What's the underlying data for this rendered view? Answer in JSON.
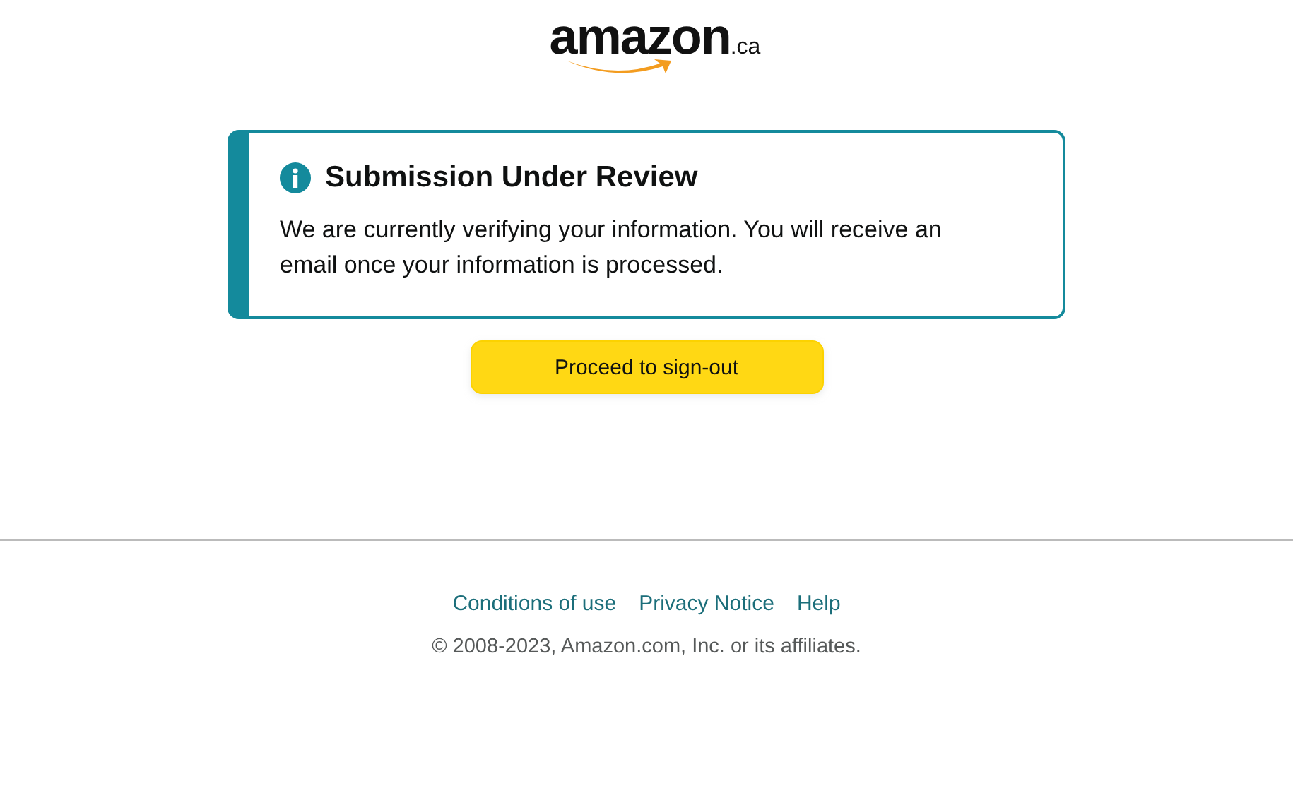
{
  "logo": {
    "wordmark": "amazon",
    "suffix": ".ca"
  },
  "alert": {
    "title": "Submission Under Review",
    "message": "We are currently verifying your information. You will receive an email once your information is processed."
  },
  "button": {
    "label": "Proceed to sign-out"
  },
  "footer": {
    "links": [
      "Conditions of use",
      "Privacy Notice",
      "Help"
    ],
    "copyright": "© 2008-2023, Amazon.com, Inc. or its affiliates."
  }
}
